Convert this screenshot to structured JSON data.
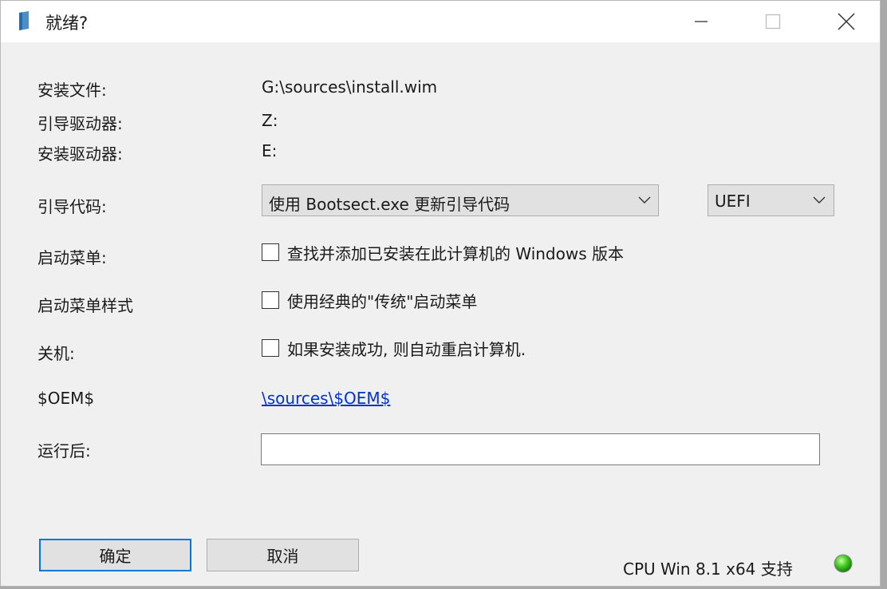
{
  "window": {
    "title": "就绪?"
  },
  "fields": {
    "install_file": {
      "label": "安装文件:",
      "value": "G:\\sources\\install.wim"
    },
    "boot_drive": {
      "label": "引导驱动器:",
      "value": "Z:"
    },
    "install_drive": {
      "label": "安装驱动器:",
      "value": "E:"
    }
  },
  "boot_code": {
    "label": "引导代码:",
    "selected": "使用 Bootsect.exe 更新引导代码",
    "firmware_selected": "UEFI"
  },
  "boot_menu": {
    "label": "启动菜单:",
    "option": "查找并添加已安装在此计算机的 Windows 版本",
    "checked": false
  },
  "boot_menu_style": {
    "label": "启动菜单样式",
    "option": "使用经典的\"传统\"启动菜单",
    "checked": false
  },
  "shutdown": {
    "label": "关机:",
    "option": "如果安装成功, 则自动重启计算机.",
    "checked": false
  },
  "oem": {
    "label": "$OEM$",
    "link": "\\sources\\$OEM$"
  },
  "after_run": {
    "label": "运行后:",
    "value": ""
  },
  "buttons": {
    "ok": "确定",
    "cancel": "取消"
  },
  "status": {
    "text": "CPU Win 8.1 x64 支持",
    "led_color": "#3cc61e"
  },
  "colors": {
    "link": "#0033cc",
    "focus_border": "#0078d7"
  }
}
